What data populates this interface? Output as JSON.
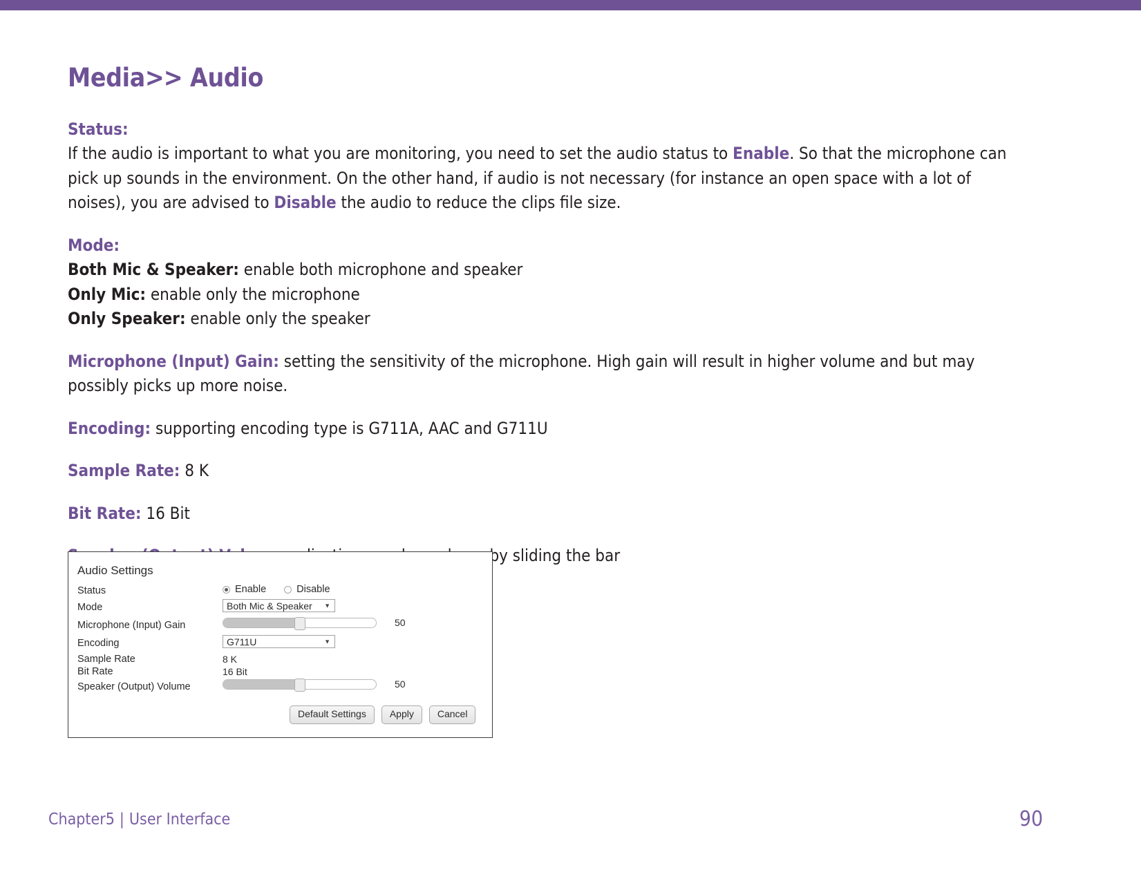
{
  "theme": {
    "accent": "#6f5296",
    "top_bar_color": "#6f5296",
    "body_text_color": "#231f20",
    "footer_color": "#7a5fa3"
  },
  "header": {
    "title_main": "Media",
    "title_chevrons": ">>",
    "title_sub": " Audio"
  },
  "sections": {
    "status": {
      "label": "Status:",
      "text_part1": "If the audio is important to what you are monitoring, you need to set the audio status to ",
      "highlight1": "Enable",
      "text_part2": ". So that the microphone can pick up sounds in the environment. On the other hand, if audio is not necessary (for instance an open space with a lot of noises), you are advised to ",
      "highlight2": "Disable",
      "text_part3": " the audio to reduce the clips file size."
    },
    "mode": {
      "label": "Mode:",
      "items": [
        {
          "term": "Both Mic & Speaker:",
          "desc": " enable both microphone and speaker"
        },
        {
          "term": "Only Mic:",
          "desc": " enable only the microphone"
        },
        {
          "term": "Only Speaker:",
          "desc": " enable only the speaker"
        }
      ]
    },
    "mic_gain": {
      "label": "Microphone (Input) Gain:",
      "text": " setting the sensitivity of the microphone. High gain will result in higher volume and but may possibly picks up more noise."
    },
    "encoding": {
      "label": "Encoding:",
      "text": " supporting encoding type is G711A, AAC and G711U"
    },
    "sample_rate": {
      "label": "Sample Rate:",
      "text": " 8 K"
    },
    "bit_rate": {
      "label": "Bit Rate:",
      "text": " 16 Bit"
    },
    "speaker_volume": {
      "label": "Speaker (Output) Volume:",
      "text": " adjusting speaker volume by sliding the bar"
    }
  },
  "ui_panel": {
    "title": "Audio Settings",
    "rows": {
      "status": {
        "label": "Status",
        "options": [
          {
            "label": "Enable",
            "selected": true
          },
          {
            "label": "Disable",
            "selected": false
          }
        ]
      },
      "mode": {
        "label": "Mode",
        "value": "Both Mic & Speaker",
        "caret": "▼"
      },
      "mic_gain": {
        "label": "Microphone (Input) Gain",
        "value": "50",
        "percent": 50
      },
      "encoding": {
        "label": "Encoding",
        "value": "G711U",
        "caret": "▼"
      },
      "sample_rate": {
        "label": "Sample Rate",
        "value": "8 K"
      },
      "bit_rate": {
        "label": "Bit Rate",
        "value": "16 Bit"
      },
      "speaker_volume": {
        "label": "Speaker (Output) Volume",
        "value": "50",
        "percent": 50
      }
    },
    "buttons": {
      "default_settings": "Default Settings",
      "apply": "Apply",
      "cancel": "Cancel"
    }
  },
  "footer": {
    "chapter": "Chapter5",
    "separator": "|",
    "section": "User Interface",
    "page_number": "90"
  }
}
